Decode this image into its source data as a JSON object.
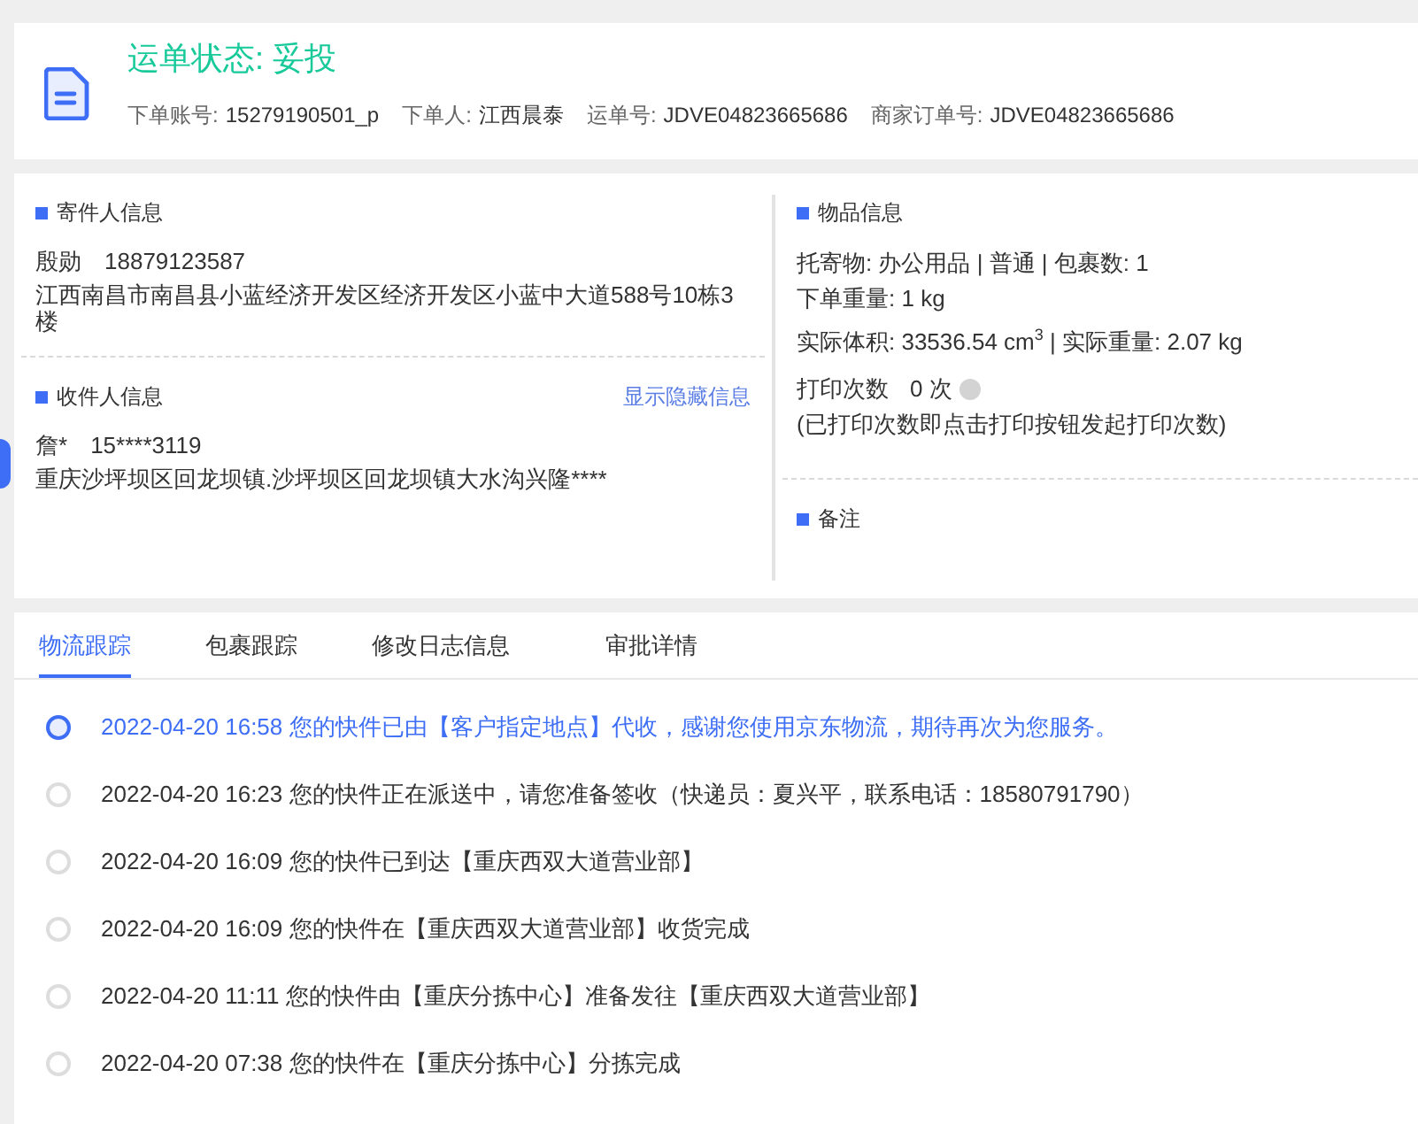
{
  "header": {
    "title": "运单状态: 妥投",
    "meta": [
      {
        "label": "下单账号:",
        "value": "15279190501_p"
      },
      {
        "label": "下单人:",
        "value": "江西晨泰"
      },
      {
        "label": "运单号:",
        "value": "JDVE04823665686"
      },
      {
        "label": "商家订单号:",
        "value": "JDVE04823665686"
      }
    ]
  },
  "sender": {
    "heading": "寄件人信息",
    "name": "殷勋",
    "phone": "18879123587",
    "address": "江西南昌市南昌县小蓝经济开发区经济开发区小蓝中大道588号10栋3楼"
  },
  "receiver": {
    "heading": "收件人信息",
    "link": "显示隐藏信息",
    "name": "詹*",
    "phone": "15****3119",
    "address": "重庆沙坪坝区回龙坝镇.沙坪坝区回龙坝镇大水沟兴隆****"
  },
  "goods": {
    "heading": "物品信息",
    "lines": [
      "托寄物:  办公用品 | 普通  |  包裹数:  1",
      "下单重量:  1 kg",
      "实际体积:   33536.54 cm$^{3}$ |  实际重量:  2.07 kg"
    ],
    "print_label": "打印次数",
    "print_count": "0 次",
    "print_note": "(已打印次数即点击打印按钮发起打印次数)"
  },
  "remarks": {
    "heading": "备注"
  },
  "tabs": [
    {
      "label": "物流跟踪",
      "selected": true
    },
    {
      "label": "包裹跟踪",
      "selected": false
    },
    {
      "label": "修改日志信息",
      "selected": false
    },
    {
      "label": "审批详情",
      "selected": false
    }
  ],
  "timeline": [
    {
      "time": "2022-04-20 16:58",
      "text": "您的快件已由【客户指定地点】代收，感谢您使用京东物流，期待再次为您服务。",
      "current": true
    },
    {
      "time": "2022-04-20 16:23",
      "text": "您的快件正在派送中，请您准备签收（快递员：夏兴平，联系电话：18580791790）",
      "current": false
    },
    {
      "time": "2022-04-20 16:09",
      "text": "您的快件已到达【重庆西双大道营业部】",
      "current": false
    },
    {
      "time": "2022-04-20 16:09",
      "text": "您的快件在【重庆西双大道营业部】收货完成",
      "current": false
    },
    {
      "time": "2022-04-20 11:11",
      "text": "您的快件由【重庆分拣中心】准备发往【重庆西双大道营业部】",
      "current": false
    },
    {
      "time": "2022-04-20 07:38",
      "text": "您的快件在【重庆分拣中心】分拣完成",
      "current": false
    }
  ]
}
